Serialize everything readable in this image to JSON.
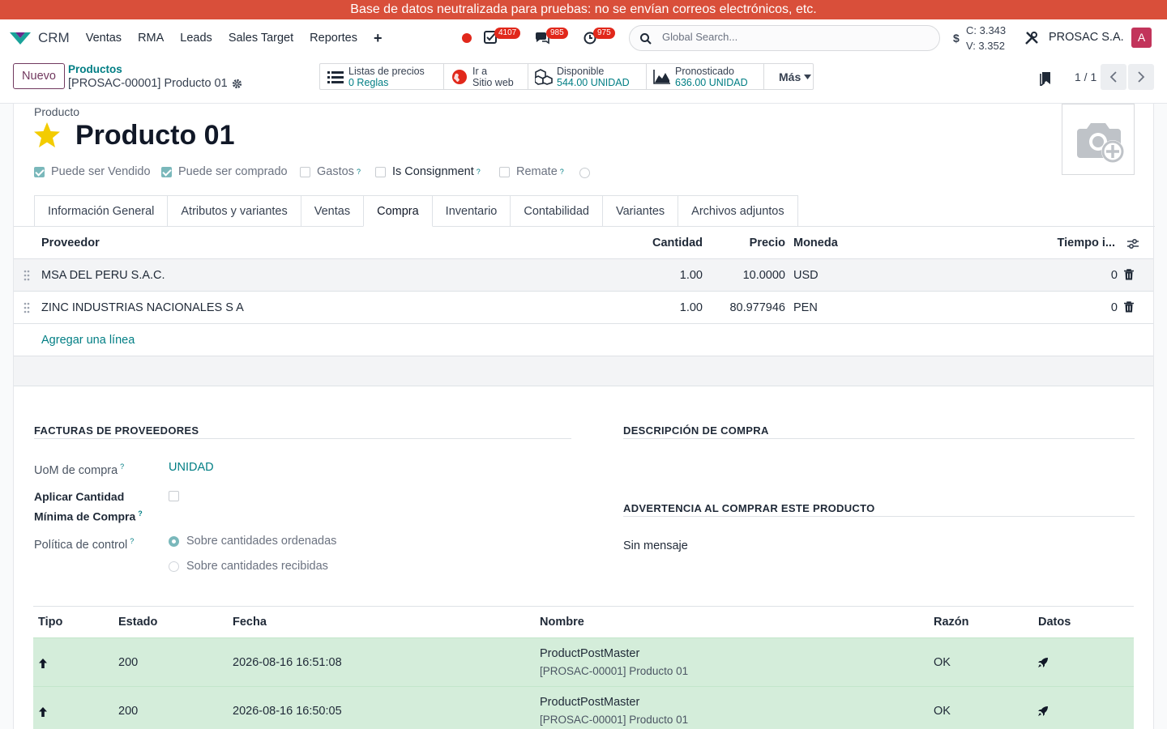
{
  "banner": "Base de datos neutralizada para pruebas: no se envían correos electrónicos, etc.",
  "navbar": {
    "app_name": "CRM",
    "menu": [
      "Ventas",
      "RMA",
      "Leads",
      "Sales Target",
      "Reportes"
    ],
    "badges": {
      "activities": "4107",
      "messages": "985",
      "timers": "975"
    },
    "search_placeholder": "Global Search...",
    "rates": {
      "symbol": "$",
      "c": "C: 3.343",
      "v": "V: 3.352"
    },
    "company": "PROSAC S.A.",
    "avatar": "A"
  },
  "control": {
    "new_label": "Nuevo",
    "breadcrumb_parent": "Productos",
    "breadcrumb_current": "[PROSAC-00001] Producto 01",
    "smart": [
      {
        "label": "Listas de precios",
        "value": "0  Reglas"
      },
      {
        "label": "Ir a",
        "value": "Sitio web"
      },
      {
        "label": "Disponible",
        "value": "544.00 UNIDAD"
      },
      {
        "label": "Pronosticado",
        "value": "636.00 UNIDAD"
      }
    ],
    "more": "Más",
    "pager": "1 / 1"
  },
  "form": {
    "type_label": "Producto",
    "name": "Producto 01",
    "checks": {
      "sold": "Puede ser Vendido",
      "purchased": "Puede ser comprado",
      "expenses": "Gastos",
      "consignment": "Is Consignment",
      "auction": "Remate"
    },
    "help": "?",
    "tabs": [
      "Información General",
      "Atributos y variantes",
      "Ventas",
      "Compra",
      "Inventario",
      "Contabilidad",
      "Variantes",
      "Archivos adjuntos"
    ],
    "vendors": {
      "headers": {
        "vendor": "Proveedor",
        "qty": "Cantidad",
        "price": "Precio",
        "currency": "Moneda",
        "lead": "Tiempo i..."
      },
      "rows": [
        {
          "vendor": "MSA DEL PERU S.A.C.",
          "qty": "1.00",
          "price": "10.0000",
          "currency": "USD",
          "lead": "0"
        },
        {
          "vendor": "ZINC INDUSTRIAS NACIONALES S A",
          "qty": "1.00",
          "price": "80.977946",
          "currency": "PEN",
          "lead": "0"
        }
      ],
      "add_line": "Agregar una línea"
    },
    "vendor_bills": {
      "title": "FACTURAS DE PROVEEDORES",
      "uom_label": "UoM de compra",
      "uom_value": "UNIDAD",
      "min_qty_label_1": "Aplicar Cantidad",
      "min_qty_label_2": "Mínima de Compra",
      "control_label": "Política de control",
      "control_ordered": "Sobre cantidades ordenadas",
      "control_received": "Sobre cantidades recibidas"
    },
    "purchase_desc_title": "DESCRIPCIÓN DE COMPRA",
    "warning_title": "ADVERTENCIA AL COMPRAR ESTE PRODUCTO",
    "warning_value": "Sin mensaje"
  },
  "logs": {
    "headers": {
      "type": "Tipo",
      "status": "Estado",
      "date": "Fecha",
      "name": "Nombre",
      "reason": "Razón",
      "data": "Datos"
    },
    "rows": [
      {
        "status": "200",
        "date": "2026-08-16 16:51:08",
        "name": "ProductPostMaster",
        "sub": "[PROSAC-00001] Producto 01",
        "reason": "OK"
      },
      {
        "status": "200",
        "date": "2026-08-16 16:50:05",
        "name": "ProductPostMaster",
        "sub": "[PROSAC-00001] Producto 01",
        "reason": "OK"
      }
    ]
  }
}
